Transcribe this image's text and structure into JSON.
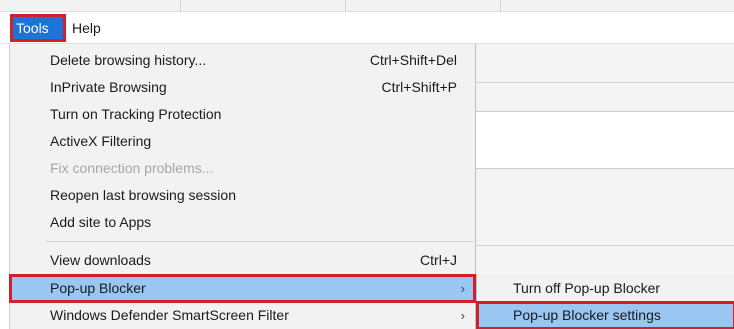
{
  "menubar": {
    "tools_label": "Tools",
    "help_label": "Help"
  },
  "tools_menu": {
    "items": [
      {
        "label": "Delete browsing history...",
        "shortcut": "Ctrl+Shift+Del"
      },
      {
        "label": "InPrivate Browsing",
        "shortcut": "Ctrl+Shift+P"
      },
      {
        "label": "Turn on Tracking Protection"
      },
      {
        "label": "ActiveX Filtering"
      },
      {
        "label": "Fix connection problems...",
        "disabled": true
      },
      {
        "label": "Reopen last browsing session"
      },
      {
        "label": "Add site to Apps"
      },
      {
        "label": "View downloads",
        "shortcut": "Ctrl+J"
      },
      {
        "label": "Pop-up Blocker",
        "arrow": "›",
        "highlighted": true
      },
      {
        "label": "Windows Defender SmartScreen Filter",
        "arrow": "›"
      }
    ]
  },
  "popup_submenu": {
    "items": [
      {
        "label": "Turn off Pop-up Blocker"
      },
      {
        "label": "Pop-up Blocker settings",
        "highlighted": true
      }
    ]
  },
  "colors": {
    "highlight": "#99c7f2",
    "annotation_border": "#d0202b",
    "tools_active": "#1e73d8",
    "disabled_text": "#a6a6a6"
  }
}
